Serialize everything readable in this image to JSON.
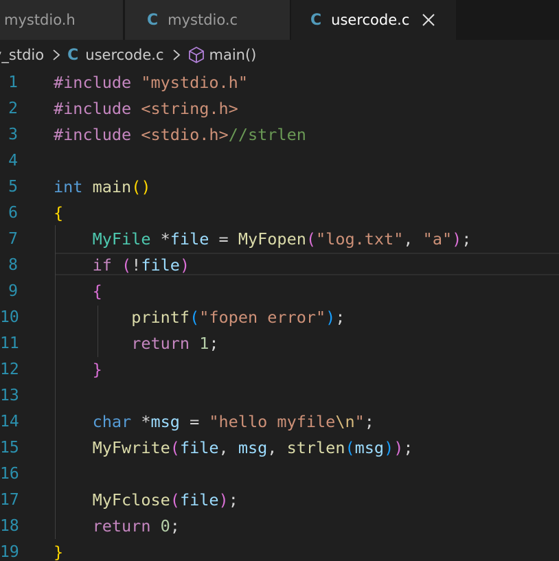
{
  "colors": {
    "editor_bg": "#1f1f1f",
    "tab_inactive_bg": "#2a2a2a",
    "c_icon": "#519aba",
    "line_number": "#2b91af"
  },
  "tabs": [
    {
      "label": "mystdio.h",
      "icon": "",
      "active": false
    },
    {
      "label": "mystdio.c",
      "icon": "C",
      "active": false
    },
    {
      "label": "usercode.c",
      "icon": "C",
      "active": true,
      "close_icon": "close-icon"
    }
  ],
  "breadcrumb": {
    "folder": "y_stdio",
    "file_icon": "C",
    "file": "usercode.c",
    "symbol_icon": "cube-icon",
    "symbol": "main()"
  },
  "editor": {
    "active_line": 8,
    "lines": [
      {
        "n": "1",
        "tokens": [
          [
            "pp",
            "#include "
          ],
          [
            "str",
            "\"mystdio.h\""
          ]
        ]
      },
      {
        "n": "2",
        "tokens": [
          [
            "pp",
            "#include "
          ],
          [
            "str",
            "<string.h>"
          ]
        ]
      },
      {
        "n": "3",
        "tokens": [
          [
            "pp",
            "#include "
          ],
          [
            "str",
            "<stdio.h>"
          ],
          [
            "cmt",
            "//strlen"
          ]
        ]
      },
      {
        "n": "4",
        "tokens": []
      },
      {
        "n": "5",
        "tokens": [
          [
            "type",
            "int"
          ],
          [
            "plain",
            " "
          ],
          [
            "fn",
            "main"
          ],
          [
            "b1",
            "()"
          ]
        ]
      },
      {
        "n": "6",
        "tokens": [
          [
            "b1",
            "{"
          ]
        ]
      },
      {
        "n": "7",
        "tokens": [
          [
            "plain",
            "    "
          ],
          [
            "tname",
            "MyFile"
          ],
          [
            "plain",
            " *"
          ],
          [
            "var",
            "file"
          ],
          [
            "plain",
            " = "
          ],
          [
            "fn",
            "MyFopen"
          ],
          [
            "b2",
            "("
          ],
          [
            "str",
            "\"log.txt\""
          ],
          [
            "plain",
            ", "
          ],
          [
            "str",
            "\"a\""
          ],
          [
            "b2",
            ")"
          ],
          [
            "plain",
            ";"
          ]
        ]
      },
      {
        "n": "8",
        "tokens": [
          [
            "plain",
            "    "
          ],
          [
            "kw",
            "if"
          ],
          [
            "plain",
            " "
          ],
          [
            "b2",
            "("
          ],
          [
            "plain",
            "!"
          ],
          [
            "var",
            "file"
          ],
          [
            "b2",
            ")"
          ]
        ]
      },
      {
        "n": "9",
        "tokens": [
          [
            "plain",
            "    "
          ],
          [
            "b2",
            "{"
          ]
        ]
      },
      {
        "n": "10",
        "tokens": [
          [
            "plain",
            "        "
          ],
          [
            "fn",
            "printf"
          ],
          [
            "b3",
            "("
          ],
          [
            "str",
            "\"fopen error\""
          ],
          [
            "b3",
            ")"
          ],
          [
            "plain",
            ";"
          ]
        ]
      },
      {
        "n": "11",
        "tokens": [
          [
            "plain",
            "        "
          ],
          [
            "kw",
            "return"
          ],
          [
            "plain",
            " "
          ],
          [
            "num",
            "1"
          ],
          [
            "plain",
            ";"
          ]
        ]
      },
      {
        "n": "12",
        "tokens": [
          [
            "plain",
            "    "
          ],
          [
            "b2",
            "}"
          ]
        ]
      },
      {
        "n": "13",
        "tokens": []
      },
      {
        "n": "14",
        "tokens": [
          [
            "plain",
            "    "
          ],
          [
            "type",
            "char"
          ],
          [
            "plain",
            " *"
          ],
          [
            "var",
            "msg"
          ],
          [
            "plain",
            " = "
          ],
          [
            "str",
            "\"hello myfile"
          ],
          [
            "esc",
            "\\n"
          ],
          [
            "str",
            "\""
          ],
          [
            "plain",
            ";"
          ]
        ]
      },
      {
        "n": "15",
        "tokens": [
          [
            "plain",
            "    "
          ],
          [
            "fn",
            "MyFwrite"
          ],
          [
            "b2",
            "("
          ],
          [
            "var",
            "file"
          ],
          [
            "plain",
            ", "
          ],
          [
            "var",
            "msg"
          ],
          [
            "plain",
            ", "
          ],
          [
            "fn",
            "strlen"
          ],
          [
            "b3",
            "("
          ],
          [
            "var",
            "msg"
          ],
          [
            "b3",
            ")"
          ],
          [
            "b2",
            ")"
          ],
          [
            "plain",
            ";"
          ]
        ]
      },
      {
        "n": "16",
        "tokens": []
      },
      {
        "n": "17",
        "tokens": [
          [
            "plain",
            "    "
          ],
          [
            "fn",
            "MyFclose"
          ],
          [
            "b2",
            "("
          ],
          [
            "var",
            "file"
          ],
          [
            "b2",
            ")"
          ],
          [
            "plain",
            ";"
          ]
        ]
      },
      {
        "n": "18",
        "tokens": [
          [
            "plain",
            "    "
          ],
          [
            "kw",
            "return"
          ],
          [
            "plain",
            " "
          ],
          [
            "num",
            "0"
          ],
          [
            "plain",
            ";"
          ]
        ]
      },
      {
        "n": "19",
        "tokens": [
          [
            "b1",
            "}"
          ]
        ]
      }
    ]
  }
}
